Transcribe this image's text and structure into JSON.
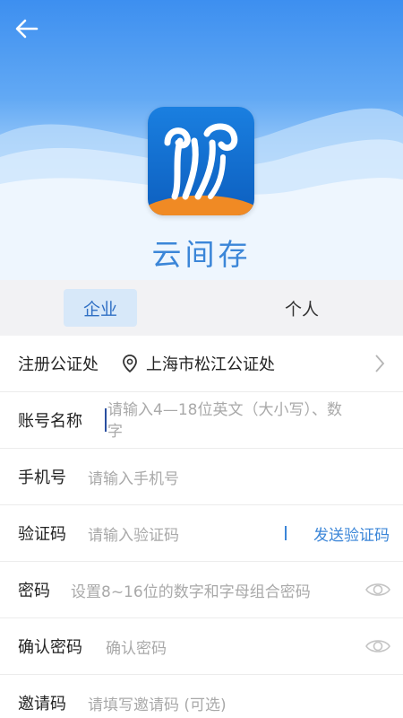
{
  "app": {
    "name": "云间存"
  },
  "tabs": {
    "enterprise": "企业",
    "personal": "个人"
  },
  "form": {
    "notary": {
      "label": "注册公证处",
      "value": "上海市松江公证处"
    },
    "account": {
      "label": "账号名称",
      "placeholder_line1": "请输入4—18位英文（大小写）、数",
      "placeholder_line2": "字"
    },
    "phone": {
      "label": "手机号",
      "placeholder": "请输入手机号"
    },
    "code": {
      "label": "验证码",
      "placeholder": "请输入验证码",
      "send": "发送验证码"
    },
    "password": {
      "label": "密码",
      "placeholder": "设置8~16位的数字和字母组合密码"
    },
    "confirm": {
      "label": "确认密码",
      "placeholder": "确认密码"
    },
    "invite": {
      "label": "邀请码",
      "placeholder": "请填写邀请码 (可选)"
    }
  },
  "colors": {
    "accent": "#3b86d8",
    "hero": "#3d8ff0",
    "tab_active_bg": "#d7e8f9"
  }
}
